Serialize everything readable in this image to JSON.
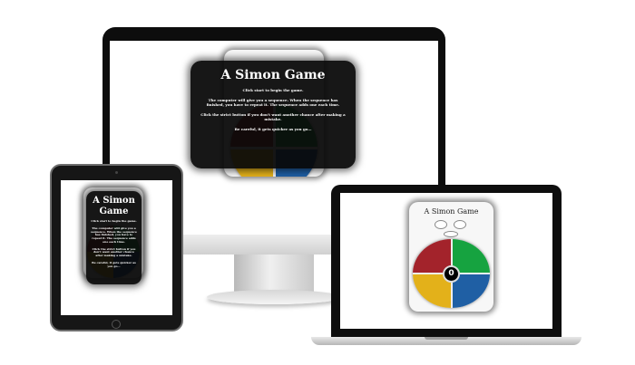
{
  "game": {
    "title": "A Simon Game",
    "line1": "Click start to begin the game.",
    "line2": "The computer will give you a sequence. When the sequence has finished, you have to repeat it. The sequence adds one each time.",
    "line3": "Click the strict button if you don't want another chance after making a mistake.",
    "line4": "Be careful, it gets quicker as you go...",
    "counter": "0"
  },
  "colors": {
    "red": "#a3232b",
    "green": "#16a340",
    "yellow": "#e3b11a",
    "blue": "#1f5fa4",
    "modal_bg": "#080808"
  },
  "icons": [
    "home-button-icon",
    "camera-icon"
  ]
}
